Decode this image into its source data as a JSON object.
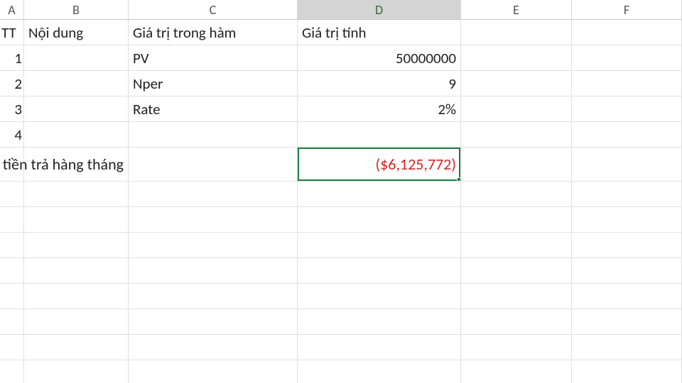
{
  "columns": [
    "A",
    "B",
    "C",
    "D",
    "E",
    "F"
  ],
  "selected_column": "D",
  "headers": {
    "tt": "TT",
    "noidung": "Nội dung",
    "ham": "Giá trị trong hàm",
    "tinh": "Giá trị tính"
  },
  "rows": [
    {
      "tt": "1",
      "label": "PV",
      "value": "50000000"
    },
    {
      "tt": "2",
      "label": "Nper",
      "value": "9"
    },
    {
      "tt": "3",
      "label": "Rate",
      "value": "2%"
    },
    {
      "tt": "4",
      "label": "",
      "value": ""
    }
  ],
  "result": {
    "label": "Số tiền trả hàng tháng",
    "value": "($6,125,772)"
  }
}
